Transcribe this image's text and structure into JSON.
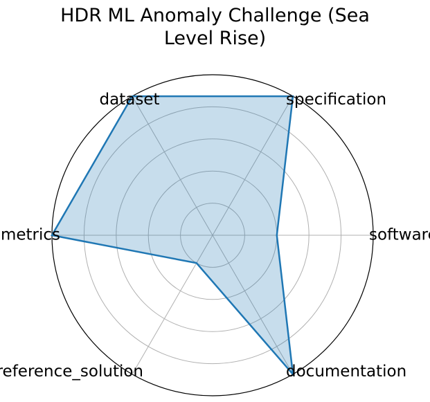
{
  "chart_data": {
    "type": "radar",
    "title_lines": [
      "HDR ML Anomaly Challenge (Sea",
      "Level Rise)"
    ],
    "axes": [
      "software",
      "specification",
      "dataset",
      "metrics",
      "reference_solution",
      "documentation"
    ],
    "values": [
      2,
      5,
      5,
      5,
      1,
      5
    ],
    "rlim": [
      0,
      5
    ],
    "rings": [
      1,
      2,
      3,
      4,
      5
    ],
    "grid": true,
    "colors": {
      "line": "#1f77b4",
      "fill": "#1f77b4",
      "grid": "#b0b0b0",
      "frame": "#000000"
    }
  }
}
